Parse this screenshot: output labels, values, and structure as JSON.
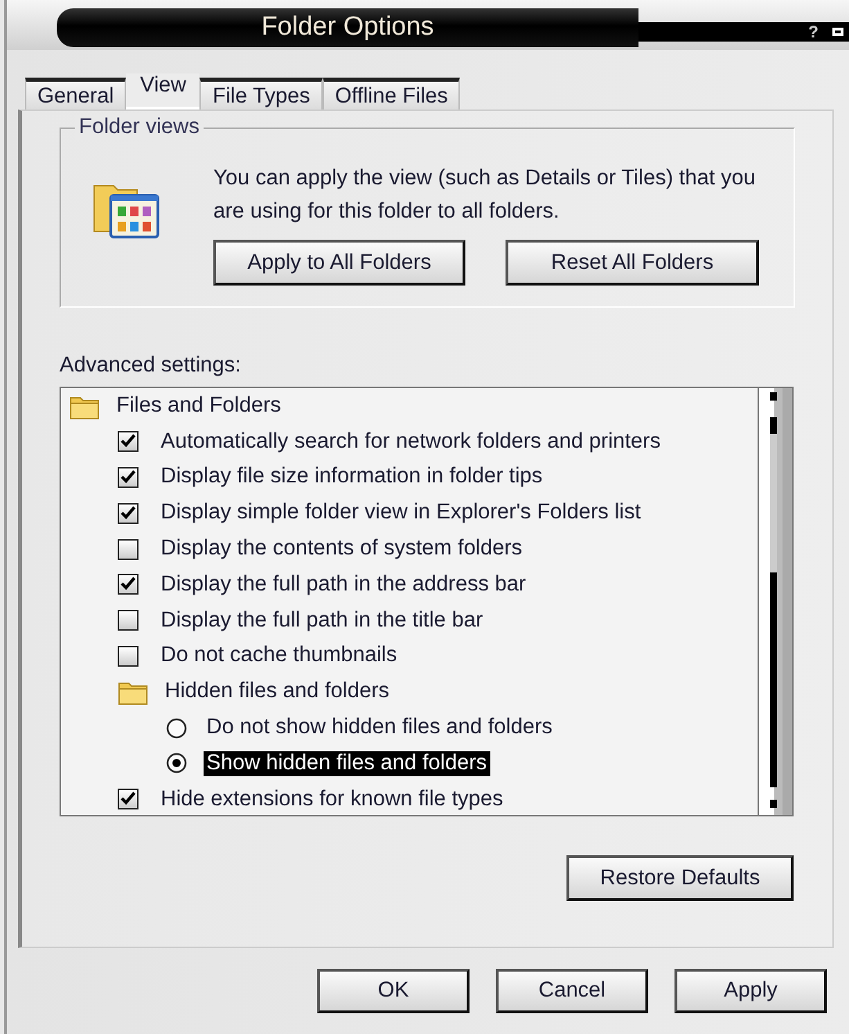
{
  "window": {
    "title": "Folder Options",
    "help_button": "?"
  },
  "tabs": [
    {
      "label": "General",
      "selected": false
    },
    {
      "label": "View",
      "selected": true
    },
    {
      "label": "File Types",
      "selected": false
    },
    {
      "label": "Offline Files",
      "selected": false
    }
  ],
  "folder_views": {
    "legend": "Folder views",
    "description": "You can apply the view (such as Details or Tiles) that you are using for this folder to all folders.",
    "buttons": [
      "Apply to All Folders",
      "Reset All Folders"
    ]
  },
  "advanced_settings": {
    "label": "Advanced settings:",
    "items": [
      {
        "kind": "folder",
        "label": "Files and Folders",
        "children": [
          {
            "kind": "checkbox",
            "label": "Automatically search for network folders and printers",
            "checked": true
          },
          {
            "kind": "checkbox",
            "label": "Display file size information in folder tips",
            "checked": true
          },
          {
            "kind": "checkbox",
            "label": "Display simple folder view in Explorer's Folders list",
            "checked": true
          },
          {
            "kind": "checkbox",
            "label": "Display the contents of system folders",
            "checked": false
          },
          {
            "kind": "checkbox",
            "label": "Display the full path in the address bar",
            "checked": true
          },
          {
            "kind": "checkbox",
            "label": "Display the full path in the title bar",
            "checked": false
          },
          {
            "kind": "checkbox",
            "label": "Do not cache thumbnails",
            "checked": false
          },
          {
            "kind": "folder",
            "label": "Hidden files and folders",
            "children": [
              {
                "kind": "radio",
                "label": "Do not show hidden files and folders",
                "selected": false
              },
              {
                "kind": "radio",
                "label": "Show hidden files and folders",
                "selected": true
              }
            ]
          },
          {
            "kind": "checkbox",
            "label": "Hide extensions for known file types",
            "checked": true
          }
        ]
      }
    ],
    "restore_button": "Restore Defaults"
  },
  "buttons": [
    "OK",
    "Cancel",
    "Apply"
  ]
}
